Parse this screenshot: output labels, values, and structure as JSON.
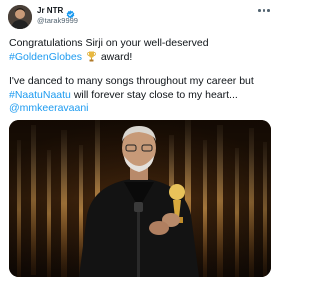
{
  "user": {
    "display_name": "Jr NTR",
    "handle": "@tarak9999",
    "verified": true,
    "verified_color": "#1d9bf0"
  },
  "tweet": {
    "line1_text": "Congratulations Sirji on your well-deserved",
    "hashtag1": "#GoldenGlobes",
    "line2_suffix": "award!",
    "paragraph2_text": "I've danced to many songs throughout my career but",
    "hashtag2": "#NaatuNaatu",
    "paragraph2_suffix": "will forever stay close to my heart...",
    "mention": "@mmkeeravaani"
  },
  "icons": {
    "verified": "verified-badge-icon",
    "more": "more-options-icon",
    "trophy": "trophy-emoji-icon"
  },
  "colors": {
    "link": "#1d9bf0",
    "text": "#0f1419",
    "secondary": "#536471"
  }
}
